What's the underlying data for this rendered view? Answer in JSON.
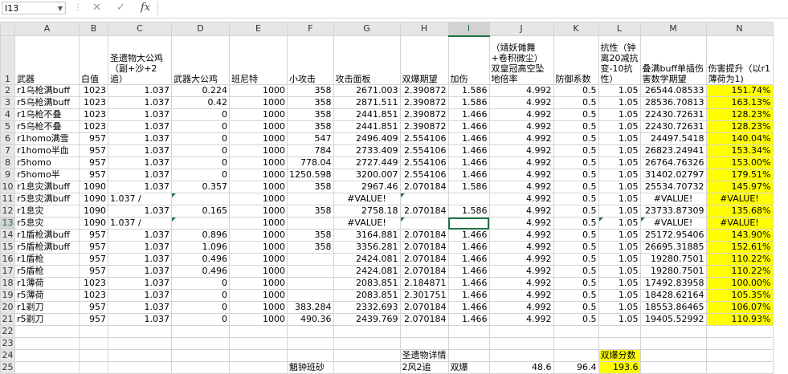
{
  "name_box": "I13",
  "columns": [
    "A",
    "B",
    "C",
    "D",
    "E",
    "F",
    "G",
    "H",
    "I",
    "J",
    "K",
    "L",
    "M",
    "N"
  ],
  "selected_column": "I",
  "selected_row": "13",
  "header_row": {
    "row": "1",
    "cells": [
      "武器",
      "白值",
      "圣遗物大公鸡（副+沙+2追）",
      "武器大公鸡",
      "班尼特",
      "小攻击",
      "攻击面板",
      "双爆期望",
      "加伤",
      "（靖妖傩舞+卷积微尘）双皇冠高空坠地倍率",
      "防御系数",
      "抗性（钟离20减抗变-10抗性）",
      "叠满buff单插伤害数学期望",
      "伤害提升（以r1薄荷为1)"
    ]
  },
  "rows": [
    {
      "row": "2",
      "cells": [
        "r1乌枪满buff",
        "1023",
        "1.037",
        "0.224",
        "1000",
        "358",
        "2671.003",
        "2.390872",
        "1.586",
        "4.992",
        "0.5",
        "1.05",
        "26544.08533",
        "151.74%"
      ]
    },
    {
      "row": "3",
      "cells": [
        "r5乌枪满buff",
        "1023",
        "1.037",
        "0.42",
        "1000",
        "358",
        "2871.511",
        "2.390872",
        "1.586",
        "4.992",
        "0.5",
        "1.05",
        "28536.70813",
        "163.13%"
      ]
    },
    {
      "row": "4",
      "cells": [
        "r1乌枪不叠",
        "1023",
        "1.037",
        "0",
        "1000",
        "358",
        "2441.851",
        "2.390872",
        "1.466",
        "4.992",
        "0.5",
        "1.05",
        "22430.72631",
        "128.23%"
      ]
    },
    {
      "row": "5",
      "cells": [
        "r5乌枪不叠",
        "1023",
        "1.037",
        "0",
        "1000",
        "358",
        "2441.851",
        "2.390872",
        "1.466",
        "4.992",
        "0.5",
        "1.05",
        "22430.72631",
        "128.23%"
      ]
    },
    {
      "row": "6",
      "cells": [
        "r1homo满雪",
        "957",
        "1.037",
        "0",
        "1000",
        "547",
        "2496.409",
        "2.554106",
        "1.466",
        "4.992",
        "0.5",
        "1.05",
        "24497.5418",
        "140.04%"
      ]
    },
    {
      "row": "7",
      "cells": [
        "r1homo半血",
        "957",
        "1.037",
        "0",
        "1000",
        "784",
        "2733.409",
        "2.554106",
        "1.466",
        "4.992",
        "0.5",
        "1.05",
        "26823.24941",
        "153.34%"
      ]
    },
    {
      "row": "8",
      "cells": [
        "r5homo",
        "957",
        "1.037",
        "0",
        "1000",
        "778.04",
        "2727.449",
        "2.554106",
        "1.466",
        "4.992",
        "0.5",
        "1.05",
        "26764.76326",
        "153.00%"
      ]
    },
    {
      "row": "9",
      "cells": [
        "r5homo半",
        "957",
        "1.037",
        "0",
        "1000",
        "1250.598",
        "3200.007",
        "2.554106",
        "1.466",
        "4.992",
        "0.5",
        "1.05",
        "31402.02797",
        "179.51%"
      ]
    },
    {
      "row": "10",
      "cells": [
        "r1息灾满buff",
        "1090",
        "1.037",
        "0.357",
        "1000",
        "358",
        "2967.46",
        "2.070184",
        "1.586",
        "4.992",
        "0.5",
        "1.05",
        "25534.70732",
        "145.97%"
      ]
    },
    {
      "row": "11",
      "cells": [
        "r5息灾满buff",
        "1090",
        "1.037 /",
        "",
        "1000",
        "",
        "#VALUE!",
        "",
        "",
        "4.992",
        "0.5",
        "1.05",
        "#VALUE!",
        "#VALUE!"
      ]
    },
    {
      "row": "12",
      "cells": [
        "r1息灾",
        "1090",
        "1.037",
        "0.165",
        "1000",
        "358",
        "2758.18",
        "2.070184",
        "1.586",
        "4.992",
        "0.5",
        "1.05",
        "23733.87309",
        "135.68%"
      ]
    },
    {
      "row": "13",
      "cells": [
        "r5息灾",
        "1090",
        "1.037 /",
        "",
        "1000",
        "",
        "#VALUE!",
        "",
        "",
        "4.992",
        "0.5",
        "1.05",
        "#VALUE!",
        "#VALUE!"
      ]
    },
    {
      "row": "14",
      "cells": [
        "r1盾枪满buff",
        "957",
        "1.037",
        "0.896",
        "1000",
        "358",
        "3164.881",
        "2.070184",
        "1.466",
        "4.992",
        "0.5",
        "1.05",
        "25172.95406",
        "143.90%"
      ]
    },
    {
      "row": "15",
      "cells": [
        "r5盾枪满buff",
        "957",
        "1.037",
        "1.096",
        "1000",
        "358",
        "3356.281",
        "2.070184",
        "1.466",
        "4.992",
        "0.5",
        "1.05",
        "26695.31885",
        "152.61%"
      ]
    },
    {
      "row": "16",
      "cells": [
        "r1盾枪",
        "957",
        "1.037",
        "0.496",
        "1000",
        "",
        "2424.081",
        "2.070184",
        "1.466",
        "4.992",
        "0.5",
        "1.05",
        "19280.7501",
        "110.22%"
      ]
    },
    {
      "row": "17",
      "cells": [
        "r5盾枪",
        "957",
        "1.037",
        "0.496",
        "1000",
        "",
        "2424.081",
        "2.070184",
        "1.466",
        "4.992",
        "0.5",
        "1.05",
        "19280.7501",
        "110.22%"
      ]
    },
    {
      "row": "18",
      "cells": [
        "r1薄荷",
        "1023",
        "1.037",
        "0",
        "1000",
        "",
        "2083.851",
        "2.184871",
        "1.466",
        "4.992",
        "0.5",
        "1.05",
        "17492.83958",
        "100.00%"
      ]
    },
    {
      "row": "19",
      "cells": [
        "r5薄荷",
        "1023",
        "1.037",
        "0",
        "1000",
        "",
        "2083.851",
        "2.301751",
        "1.466",
        "4.992",
        "0.5",
        "1.05",
        "18428.62164",
        "105.35%"
      ]
    },
    {
      "row": "20",
      "cells": [
        "r1剃刀",
        "957",
        "1.037",
        "0",
        "1000",
        "383.284",
        "2332.693",
        "2.070184",
        "1.466",
        "4.992",
        "0.5",
        "1.05",
        "18553.86465",
        "106.07%"
      ]
    },
    {
      "row": "21",
      "cells": [
        "r5剃刀",
        "957",
        "1.037",
        "0",
        "1000",
        "490.36",
        "2439.769",
        "2.070184",
        "1.466",
        "4.992",
        "0.5",
        "1.05",
        "19405.52992",
        "110.93%"
      ]
    }
  ],
  "extra_rows": [
    {
      "row": "22",
      "cells": [
        "",
        "",
        "",
        "",
        "",
        "",
        "",
        "",
        "",
        "",
        "",
        "",
        "",
        ""
      ]
    },
    {
      "row": "23",
      "cells": [
        "",
        "",
        "",
        "",
        "",
        "",
        "",
        "",
        "",
        "",
        "",
        "",
        "",
        ""
      ]
    },
    {
      "row": "24",
      "cells": [
        "",
        "",
        "",
        "",
        "",
        "",
        "",
        "圣遗物详情",
        "",
        "",
        "",
        "双爆分数",
        "",
        ""
      ]
    },
    {
      "row": "25",
      "cells": [
        "",
        "",
        "",
        "",
        "",
        "魈钟班砂",
        "",
        "2风2追",
        "双爆",
        "48.6",
        "96.4",
        "193.6",
        "",
        ""
      ]
    }
  ],
  "colors": {
    "accent": "#217346",
    "highlight": "#ffff00",
    "header_bg": "#e6e6e6"
  }
}
